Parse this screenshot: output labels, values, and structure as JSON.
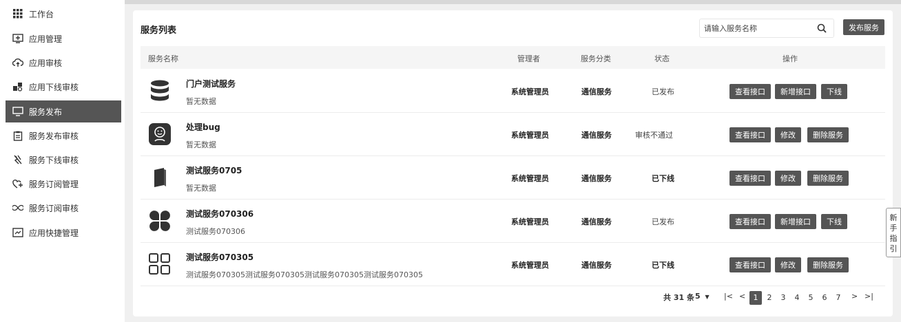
{
  "sidebar": {
    "items": [
      {
        "label": "工作台",
        "icon": "grid-icon"
      },
      {
        "label": "应用管理",
        "icon": "app-box-icon"
      },
      {
        "label": "应用审核",
        "icon": "cloud-upload-icon"
      },
      {
        "label": "应用下线审核",
        "icon": "cubes-icon"
      },
      {
        "label": "服务发布",
        "icon": "monitor-icon",
        "active": true
      },
      {
        "label": "服务发布审核",
        "icon": "clipboard-icon"
      },
      {
        "label": "服务下线审核",
        "icon": "plug-off-icon"
      },
      {
        "label": "服务订阅管理",
        "icon": "heart-plus-icon"
      },
      {
        "label": "服务订阅审核",
        "icon": "infinity-icon"
      },
      {
        "label": "应用快捷管理",
        "icon": "shortcut-icon"
      }
    ]
  },
  "main": {
    "title": "服务列表",
    "search": {
      "placeholder": "请输入服务名称",
      "value": ""
    },
    "publish_button": "发布服务",
    "table": {
      "headers": {
        "name": "服务名称",
        "manager": "管理者",
        "category": "服务分类",
        "status": "状态",
        "actions": "操作"
      },
      "rows": [
        {
          "icon": "database-icon",
          "name": "门户测试服务",
          "desc": "暂无数据",
          "manager": "系统管理员",
          "category": "通信服务",
          "status": "已发布",
          "status_bold": false,
          "actions": [
            "查看接口",
            "新增接口",
            "下线"
          ]
        },
        {
          "icon": "face-badge-icon",
          "name": "处理bug",
          "desc": "暂无数据",
          "manager": "系统管理员",
          "category": "通信服务",
          "status": "审核不通过",
          "status_bold": false,
          "actions": [
            "查看接口",
            "修改",
            "删除服务"
          ]
        },
        {
          "icon": "book-icon",
          "name": "测试服务0705",
          "desc": "暂无数据",
          "manager": "系统管理员",
          "category": "通信服务",
          "status": "已下线",
          "status_bold": true,
          "actions": [
            "查看接口",
            "修改",
            "删除服务"
          ]
        },
        {
          "icon": "petals-icon",
          "name": "测试服务070306",
          "desc": "测试服务070306",
          "manager": "系统管理员",
          "category": "通信服务",
          "status": "已发布",
          "status_bold": false,
          "actions": [
            "查看接口",
            "新增接口",
            "下线"
          ]
        },
        {
          "icon": "squares-icon",
          "name": "测试服务070305",
          "desc": "测试服务070305测试服务070305测试服务070305测试服务070305",
          "manager": "系统管理员",
          "category": "通信服务",
          "status": "已下线",
          "status_bold": true,
          "actions": [
            "查看接口",
            "修改",
            "删除服务"
          ]
        }
      ]
    },
    "pagination": {
      "total": "共 31 条",
      "page_size": "5",
      "first": "|<",
      "prev": "<",
      "pages": [
        "1",
        "2",
        "3",
        "4",
        "5",
        "6",
        "7"
      ],
      "current": "1",
      "next": ">",
      "last": ">|"
    }
  },
  "guide": {
    "text": "新手指引"
  },
  "colors": {
    "accent": "#555555",
    "header_bg": "#f5f5f5",
    "page_bg": "#f0f0f0"
  }
}
